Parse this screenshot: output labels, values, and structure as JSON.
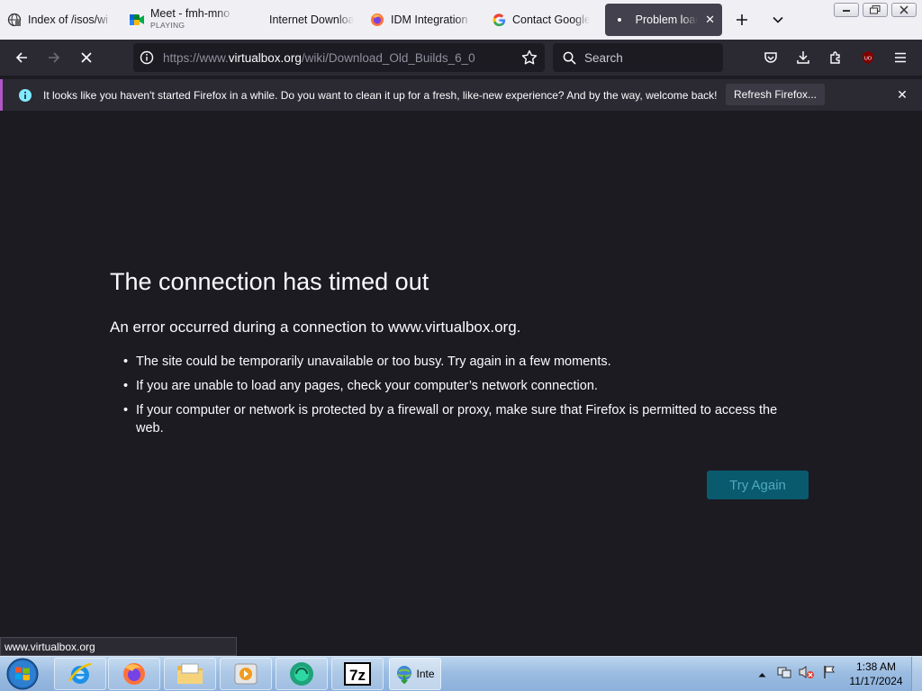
{
  "tabs": [
    {
      "title": "Index of /isos/wi",
      "icon": "server-globe-icon"
    },
    {
      "title": "Meet - fmh-mno",
      "subtitle": "PLAYING",
      "icon": "google-meet-icon"
    },
    {
      "title": "Internet Downloa",
      "icon": "none"
    },
    {
      "title": "IDM Integration",
      "icon": "firefox-icon"
    },
    {
      "title": "Contact Google",
      "icon": "google-g-icon"
    },
    {
      "title": "Problem loadi",
      "icon": "loading-dot",
      "active": true
    }
  ],
  "url": {
    "prefix": "https://www.",
    "host": "virtualbox.org",
    "path": "/wiki/Download_Old_Builds_6_0"
  },
  "search": {
    "placeholder": "Search"
  },
  "notification": {
    "message": "It looks like you haven't started Firefox in a while. Do you want to clean it up for a fresh, like-new experience? And by the way, welcome back!",
    "button": "Refresh Firefox..."
  },
  "error": {
    "title": "The connection has timed out",
    "subtitle": "An error occurred during a connection to www.virtualbox.org.",
    "items": [
      "The site could be temporarily unavailable or too busy. Try again in a few moments.",
      "If you are unable to load any pages, check your computer’s network connection.",
      "If your computer or network is protected by a firewall or proxy, make sure that Firefox is permitted to access the web."
    ],
    "button": "Try Again"
  },
  "status_url": "www.virtualbox.org",
  "taskbar": {
    "active_label": "Inte",
    "time": "1:38 AM",
    "date": "11/17/2024"
  },
  "colors": {
    "page_bg": "#1c1b22",
    "toolbar_bg": "#2b2a33",
    "try_again_bg": "#0a5a6e",
    "notify_accent": "#b056c9"
  }
}
